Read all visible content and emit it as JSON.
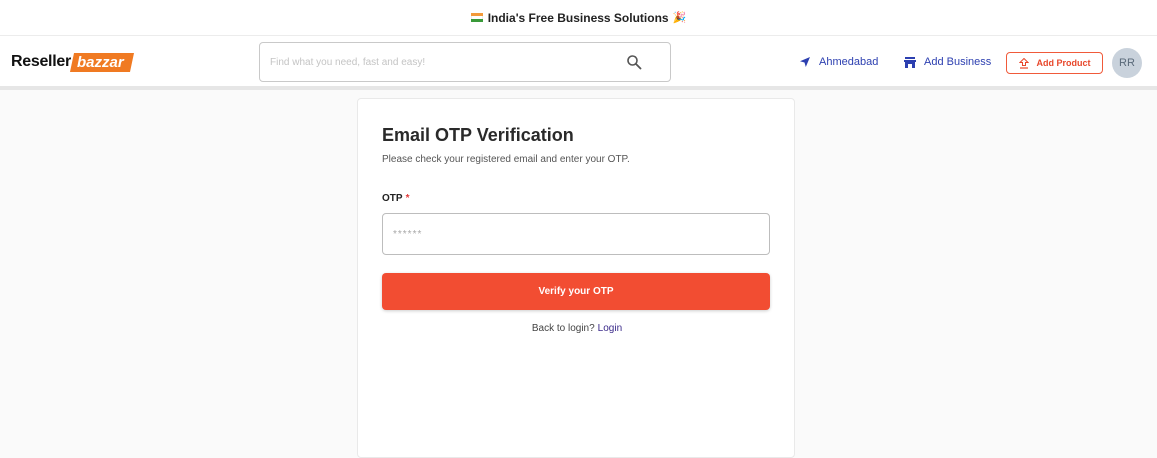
{
  "topbar": {
    "text": "India's Free Business Solutions",
    "flag_icon": "india-flag-icon",
    "celebration_icon": "party-popper-icon"
  },
  "header": {
    "logo": {
      "part1": "Reseller",
      "part2": "bazzar"
    },
    "search": {
      "placeholder": "Find what you need, fast and easy!",
      "value": "",
      "icon": "search-icon"
    },
    "location": {
      "label": "Ahmedabad",
      "icon": "location-arrow-icon"
    },
    "add_business": {
      "label": "Add Business",
      "icon": "store-icon"
    },
    "add_product": {
      "label": "Add Product",
      "icon": "upload-icon"
    },
    "avatar_initials": "RR"
  },
  "form": {
    "title": "Email OTP Verification",
    "subtitle": "Please check your registered email and enter your OTP.",
    "otp_label": "OTP",
    "otp_required": "*",
    "otp_placeholder": "******",
    "otp_value": "",
    "verify_label": "Verify your OTP",
    "back_text": "Back to login?",
    "login_link": "Login"
  },
  "colors": {
    "accent": "#f24d32",
    "link": "#2c3fb0",
    "logo_orange": "#f07a22"
  }
}
